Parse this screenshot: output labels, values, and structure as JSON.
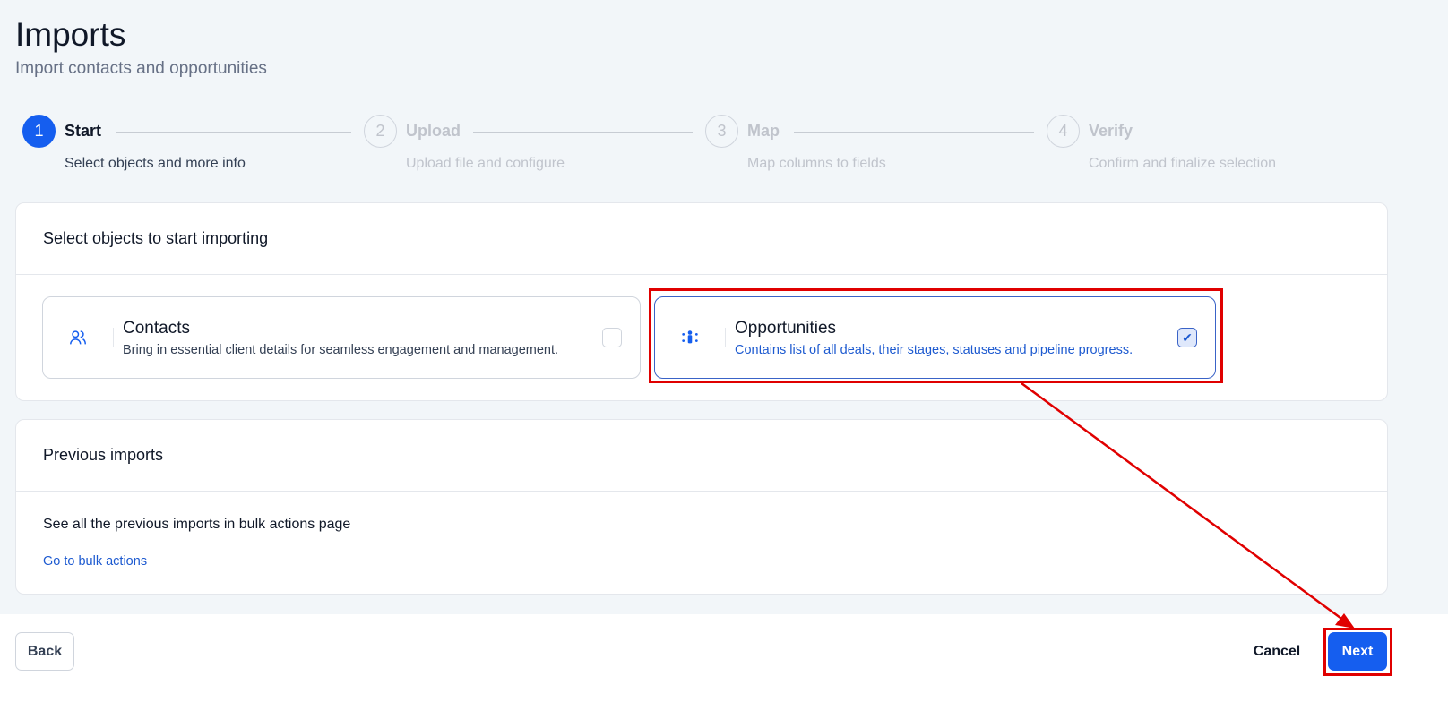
{
  "header": {
    "title": "Imports",
    "subtitle": "Import contacts and opportunities"
  },
  "steps": [
    {
      "num": "1",
      "label": "Start",
      "desc": "Select objects and more info"
    },
    {
      "num": "2",
      "label": "Upload",
      "desc": "Upload file and configure"
    },
    {
      "num": "3",
      "label": "Map",
      "desc": "Map columns to fields"
    },
    {
      "num": "4",
      "label": "Verify",
      "desc": "Confirm and finalize selection"
    }
  ],
  "select_card": {
    "title": "Select objects to start importing",
    "options": [
      {
        "title": "Contacts",
        "desc": "Bring in essential client details for seamless engagement and management.",
        "checked": false
      },
      {
        "title": "Opportunities",
        "desc": "Contains list of all deals, their stages, statuses and pipeline progress.",
        "checked": true
      }
    ]
  },
  "previous_card": {
    "title": "Previous imports",
    "text": "See all the previous imports in bulk actions page",
    "link": "Go to bulk actions"
  },
  "footer": {
    "back": "Back",
    "cancel": "Cancel",
    "next": "Next"
  },
  "colors": {
    "accent": "#155eef",
    "annotation": "#e00000"
  }
}
